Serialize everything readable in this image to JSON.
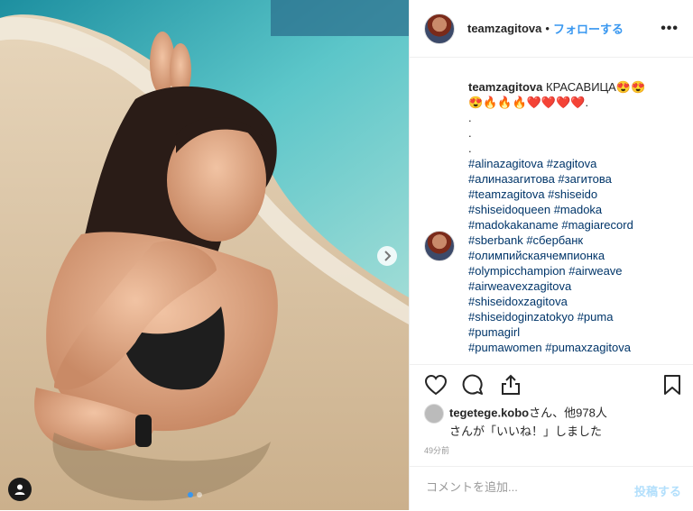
{
  "header": {
    "username": "teamzagitova",
    "bullet": "•",
    "follow_label": "フォローする",
    "more_label": "•••"
  },
  "caption": {
    "username": "teamzagitova",
    "text_line1": "КРАСАВИЦА😍😍",
    "text_line2": "😍🔥🔥🔥❤️❤️❤️❤️.",
    "dots": [
      ".",
      ".",
      "."
    ],
    "hashtags": [
      "#alinazagitova #zagitova",
      "#алиназагитова #загитова",
      "#teamzagitova #shiseido",
      "#shiseidoqueen #madoka",
      "#madokakaname #magiarecord",
      "#sberbank #сбербанк",
      "#олимпийскаячемпионка",
      "#olympicchampion #airweave",
      "#airweavexzagitova",
      "#shiseidoxzagitova",
      "#shiseidoginzatokyo #puma",
      "#pumagirl",
      "#pumawomen #pumaxzagitova"
    ]
  },
  "likes": {
    "user": "tegetege.kobo",
    "suffix": "さん、他978人",
    "line2": "さんが「いいね！」しました"
  },
  "timestamp": "49分前",
  "comment": {
    "placeholder": "コメントを追加...",
    "post_label": "投稿する"
  },
  "colors": {
    "link": "#3897f0",
    "hashtag": "#003569",
    "post_disabled": "#b2dffc"
  },
  "icons": [
    "heart-icon",
    "comment-icon",
    "share-icon",
    "bookmark-icon",
    "chevron-right-icon",
    "user-tag-icon"
  ]
}
